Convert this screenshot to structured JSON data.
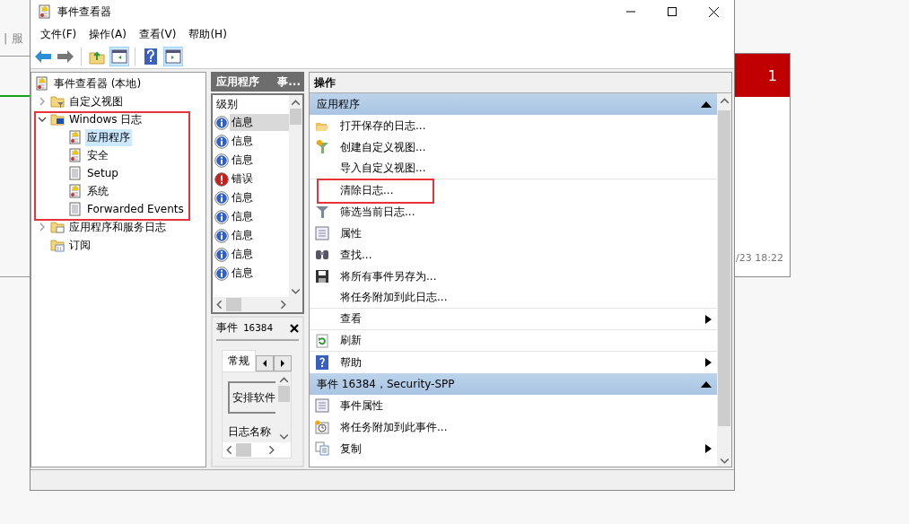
{
  "background_app": {
    "tab_label": "| 服",
    "badge": "1",
    "timestamp": "/23 18:22"
  },
  "window": {
    "title": "事件查看器"
  },
  "menu": [
    "文件(F)",
    "操作(A)",
    "查看(V)",
    "帮助(H)"
  ],
  "toolbar": [
    {
      "kind": "back"
    },
    {
      "kind": "forward"
    },
    {
      "kind": "separator"
    },
    {
      "kind": "up"
    },
    {
      "kind": "pane-left",
      "selected": true
    },
    {
      "kind": "separator"
    },
    {
      "kind": "help"
    },
    {
      "kind": "pane-right",
      "selected": true
    }
  ],
  "tree": {
    "items": [
      {
        "label": "事件查看器 (本地)",
        "kind": "log",
        "selected": false,
        "children": [
          {
            "label": "自定义视图",
            "kind": "folder-filter",
            "expanded": false,
            "selected": false
          },
          {
            "label": "Windows 日志",
            "kind": "folder-windows",
            "expanded": true,
            "selected": false,
            "children": [
              {
                "label": "应用程序",
                "kind": "log",
                "selected": true
              },
              {
                "label": "安全",
                "kind": "log",
                "selected": false
              },
              {
                "label": "Setup",
                "kind": "log-plain",
                "selected": false
              },
              {
                "label": "系统",
                "kind": "log",
                "selected": false
              },
              {
                "label": "Forwarded Events",
                "kind": "log-plain",
                "selected": false
              }
            ]
          },
          {
            "label": "应用程序和服务日志",
            "kind": "folder",
            "expanded": false,
            "selected": false
          },
          {
            "label": "订阅",
            "kind": "folder-sub",
            "selected": false
          }
        ]
      }
    ]
  },
  "events_pane": {
    "title": "应用程序",
    "title_2": "事...",
    "column": "级别",
    "rows": [
      {
        "kind": "info",
        "label": "信息",
        "selected": true
      },
      {
        "kind": "info",
        "label": "信息",
        "selected": false
      },
      {
        "kind": "info",
        "label": "信息",
        "selected": false
      },
      {
        "kind": "error",
        "label": "错误",
        "selected": false
      },
      {
        "kind": "info",
        "label": "信息",
        "selected": false
      },
      {
        "kind": "info",
        "label": "信息",
        "selected": false
      },
      {
        "kind": "info",
        "label": "信息",
        "selected": false
      },
      {
        "kind": "info",
        "label": "信息",
        "selected": false
      },
      {
        "kind": "info",
        "label": "信息",
        "selected": false
      }
    ]
  },
  "event_preview": {
    "title": "事件",
    "number": "16384",
    "tab": "常规",
    "field_value": "安排软件",
    "label": "日志名称"
  },
  "actions": {
    "title": "操作",
    "sections": [
      {
        "title": "应用程序",
        "expanded": true,
        "items": [
          {
            "label": "打开保存的日志...",
            "kind": "open",
            "submenu": false,
            "separator_after": false
          },
          {
            "label": "创建自定义视图...",
            "kind": "filter-new",
            "submenu": false,
            "separator_after": false
          },
          {
            "label": "导入自定义视图...",
            "kind": "none",
            "submenu": false,
            "separator_after": true
          },
          {
            "label": "清除日志...",
            "kind": "none",
            "submenu": false,
            "separator_after": false
          },
          {
            "label": "筛选当前日志...",
            "kind": "filter",
            "submenu": false,
            "separator_after": false
          },
          {
            "label": "属性",
            "kind": "properties",
            "submenu": false,
            "separator_after": false
          },
          {
            "label": "查找...",
            "kind": "find",
            "submenu": false,
            "separator_after": false
          },
          {
            "label": "将所有事件另存为...",
            "kind": "save",
            "submenu": false,
            "separator_after": false
          },
          {
            "label": "将任务附加到此日志...",
            "kind": "none",
            "submenu": false,
            "separator_after": true
          },
          {
            "label": "查看",
            "kind": "none",
            "submenu": true,
            "separator_after": true
          },
          {
            "label": "刷新",
            "kind": "refresh",
            "submenu": false,
            "separator_after": true
          },
          {
            "label": "帮助",
            "kind": "help",
            "submenu": true,
            "separator_after": false
          }
        ]
      },
      {
        "title": "事件 16384，Security-SPP",
        "expanded": true,
        "items": [
          {
            "label": "事件属性",
            "kind": "properties",
            "submenu": false,
            "separator_after": false
          },
          {
            "label": "将任务附加到此事件...",
            "kind": "task",
            "submenu": false,
            "separator_after": false
          },
          {
            "label": "复制",
            "kind": "copy",
            "submenu": true,
            "separator_after": false
          }
        ]
      }
    ]
  }
}
